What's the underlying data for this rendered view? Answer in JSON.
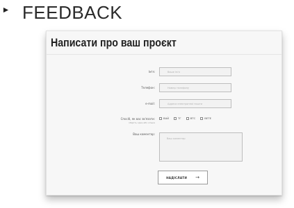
{
  "section": {
    "title": "FEEDBACK"
  },
  "form": {
    "title": "Написати про ваш проєкт",
    "fields": [
      {
        "label": "Ім'я:",
        "placeholder": "Ваше ім'я"
      },
      {
        "label": "Телефон:",
        "placeholder": "Номер телефону"
      },
      {
        "label": "e-mail:",
        "placeholder": "Адреса електронної пошти"
      }
    ],
    "checks": {
      "label": "Спосіб, як вас зв'язати:",
      "sublabel": "оберіть один або кілька",
      "options": [
        "ВАЙ",
        "ТГ",
        "ВТС",
        "ВЕТЕ"
      ]
    },
    "comment": {
      "label": "Ваш коментар:",
      "placeholder": "Ваш коментар"
    },
    "submit_label": "НАДІСЛАТИ",
    "submit_icon": "→"
  }
}
